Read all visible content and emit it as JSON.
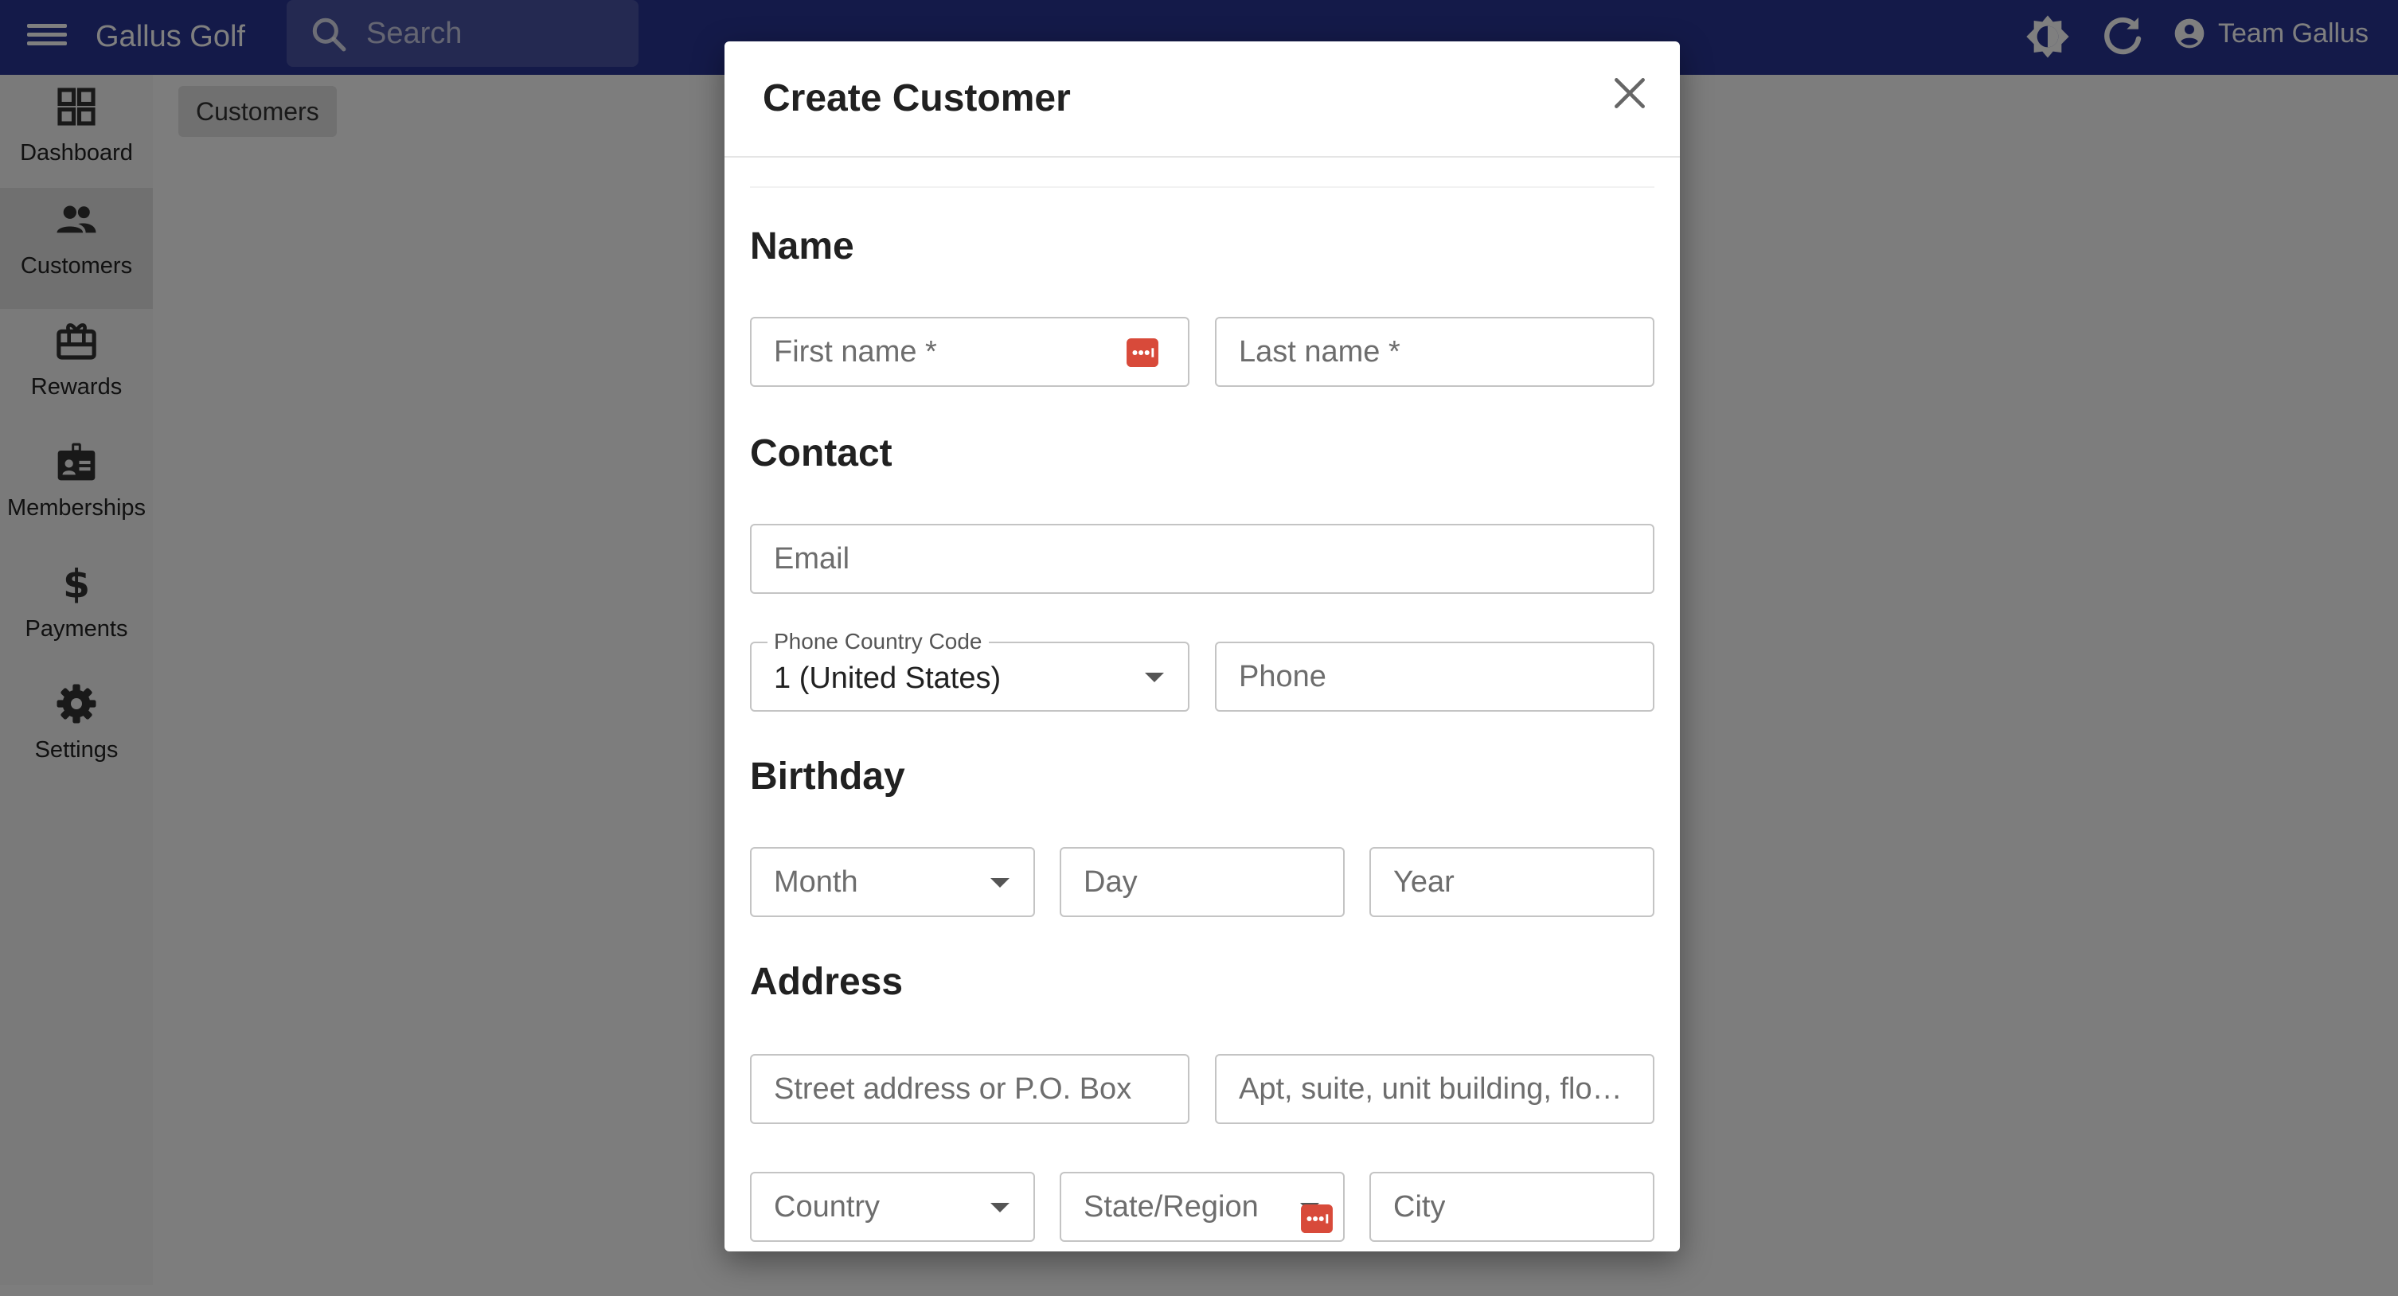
{
  "appbar": {
    "title": "Gallus Golf",
    "search_placeholder": "Search",
    "team_name": "Team Gallus"
  },
  "sidebar": {
    "items": [
      {
        "label": "Dashboard",
        "icon": "dashboard-icon"
      },
      {
        "label": "Customers",
        "icon": "people-icon",
        "active": true
      },
      {
        "label": "Rewards",
        "icon": "rewards-icon"
      },
      {
        "label": "Memberships",
        "icon": "membership-card-icon"
      },
      {
        "label": "Payments",
        "icon": "dollar-icon"
      },
      {
        "label": "Settings",
        "icon": "gear-icon"
      }
    ]
  },
  "breadcrumb": "Customers",
  "dialog": {
    "title": "Create Customer",
    "sections": {
      "name": "Name",
      "contact": "Contact",
      "birthday": "Birthday",
      "address": "Address"
    },
    "fields": {
      "first_name": "First name *",
      "last_name": "Last name *",
      "email": "Email",
      "phone_country_code_label": "Phone Country Code",
      "phone_country_code_value": "1 (United States)",
      "phone": "Phone",
      "month": "Month",
      "day": "Day",
      "year": "Year",
      "street": "Street address or P.O. Box",
      "apt": "Apt, suite, unit building, floor, etc.",
      "country": "Country",
      "state": "State/Region",
      "city": "City"
    }
  },
  "colors": {
    "appbar": "#283593",
    "password_manager": "#d84a3a"
  }
}
